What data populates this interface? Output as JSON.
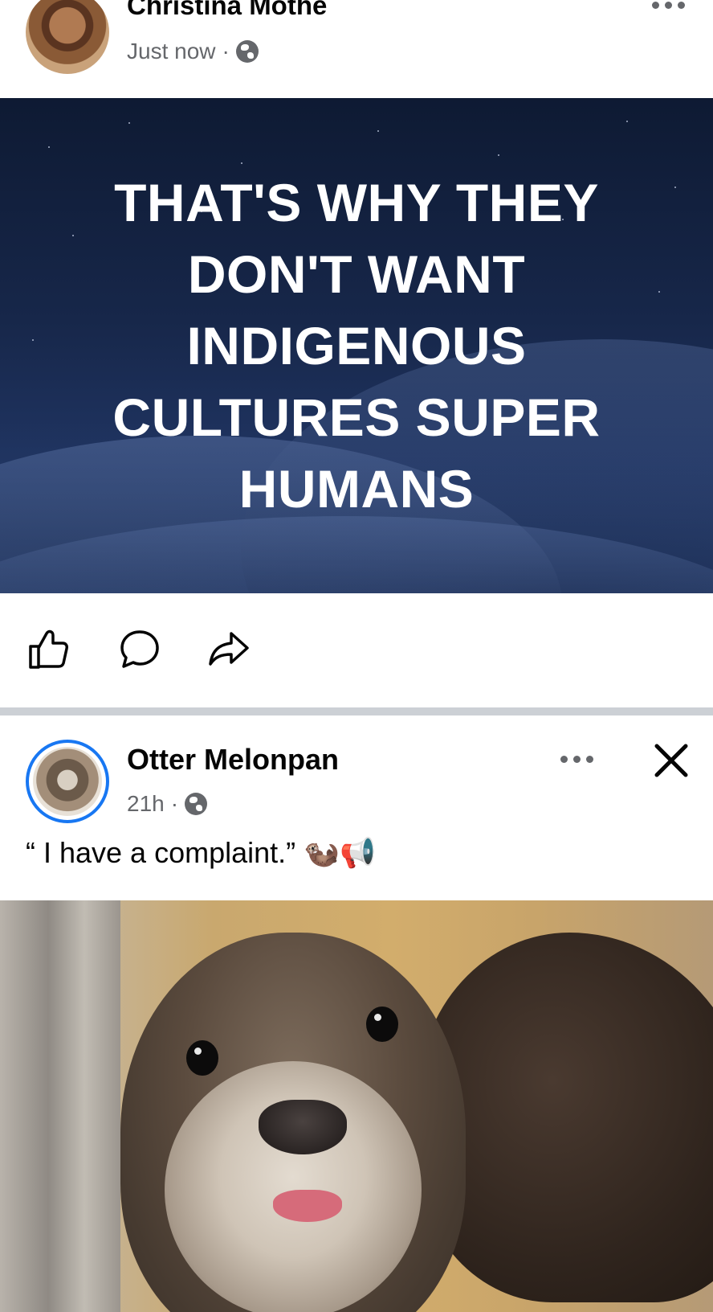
{
  "post1": {
    "author": "Christina Mothe",
    "time": "Just now",
    "separator": "·",
    "privacy_icon": "globe-icon",
    "quote_lines": [
      "THAT'S WHY THEY",
      "DON'T WANT",
      "INDIGENOUS",
      "CULTURES SUPER",
      "HUMANS"
    ],
    "actions": [
      "like-icon",
      "comment-icon",
      "share-icon"
    ]
  },
  "post2": {
    "author": "Otter Melonpan",
    "time": "21h",
    "separator": "·",
    "privacy_icon": "globe-icon",
    "caption": "“ I have a complaint.” 🦦📢"
  },
  "colors": {
    "accent_blue": "#1877f2",
    "secondary_text": "#65676b",
    "primary_text": "#050505",
    "divider": "#ccd0d5"
  }
}
